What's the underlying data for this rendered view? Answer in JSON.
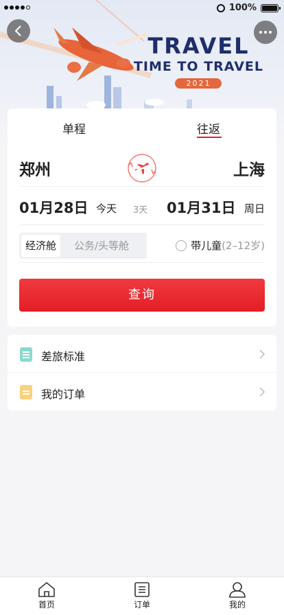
{
  "status_bar": {
    "battery": "100%"
  },
  "banner": {
    "title": "TRAVEL",
    "subtitle": "TIME TO TRAVEL",
    "year": "2021"
  },
  "trip_tabs": [
    {
      "label": "单程",
      "selected": false
    },
    {
      "label": "往返",
      "selected": true
    }
  ],
  "route": {
    "from": "郑州",
    "to": "上海"
  },
  "dates": {
    "departure": "01月28日",
    "departure_day": "今天",
    "duration": "3天",
    "return": "01月31日",
    "return_day": "周日"
  },
  "cabin": {
    "economy": "经济舱",
    "business": "公务/头等舱",
    "selected": "经济舱"
  },
  "child": {
    "label": "带儿童",
    "age": "(2–12岁)",
    "checked": false
  },
  "search_label": "查询",
  "menu": [
    {
      "label": "差旅标准",
      "icon": "document-icon"
    },
    {
      "label": "我的订单",
      "icon": "order-icon"
    }
  ],
  "tabbar": [
    {
      "label": "首页",
      "icon": "home-icon"
    },
    {
      "label": "订单",
      "icon": "list-icon"
    },
    {
      "label": "我的",
      "icon": "user-icon"
    }
  ],
  "colors": {
    "accent": "#e41e26",
    "banner_navy": "#1f2e6b",
    "banner_orange": "#e4673d"
  }
}
